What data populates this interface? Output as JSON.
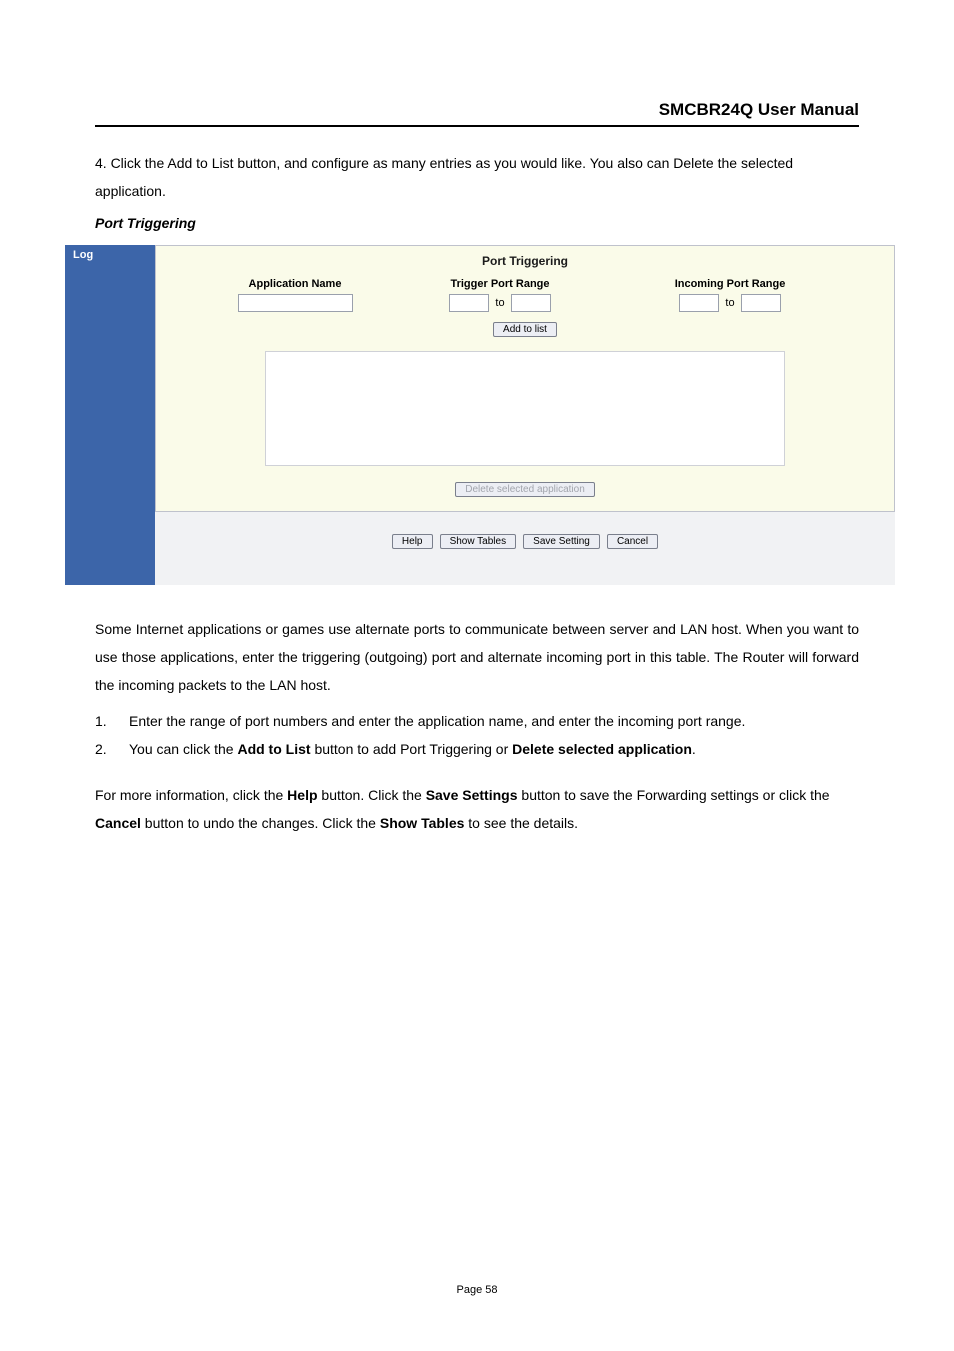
{
  "doc": {
    "title": "SMCBR24Q User Manual",
    "intro": "4. Click the Add to List button, and configure as many entries as you would like. You also can Delete the selected application.",
    "subhead": "Port Triggering"
  },
  "shot": {
    "side_label": "Log",
    "panel_title": "Port Triggering",
    "cols": {
      "app": "Application Name",
      "trig": "Trigger Port Range",
      "inc": "Incoming Port Range"
    },
    "to": "to",
    "inputs": {
      "app": "",
      "trig_from": "",
      "trig_to": "",
      "inc_from": "",
      "inc_to": ""
    },
    "btn_add": "Add to list",
    "btn_delete": "Delete selected application",
    "btn_help": "Help",
    "btn_show": "Show Tables",
    "btn_save": "Save Setting",
    "btn_cancel": "Cancel"
  },
  "body": {
    "p1": "Some Internet applications or games use alternate ports to communicate between server and LAN host. When you want to use those applications, enter the triggering (outgoing) port and alternate incoming port in this table. The Router will forward the incoming packets to the LAN host.",
    "li1": "Enter the range of port numbers and enter the application name, and enter the incoming port range.",
    "li2_a": "You can click the ",
    "li2_b": "Add to List",
    "li2_c": " button to add Port Triggering or ",
    "li2_d": "Delete selected application",
    "li2_e": ".",
    "p2_a": "For more information, click the ",
    "p2_b": "Help",
    "p2_c": " button. Click the ",
    "p2_d": "Save Settings",
    "p2_e": " button to save the Forwarding settings or click the ",
    "p2_f": "Cancel",
    "p2_g": " button to undo the changes. Click the ",
    "p2_h": "Show Tables",
    "p2_i": " to see the details."
  },
  "footer": {
    "page": "Page 58"
  }
}
